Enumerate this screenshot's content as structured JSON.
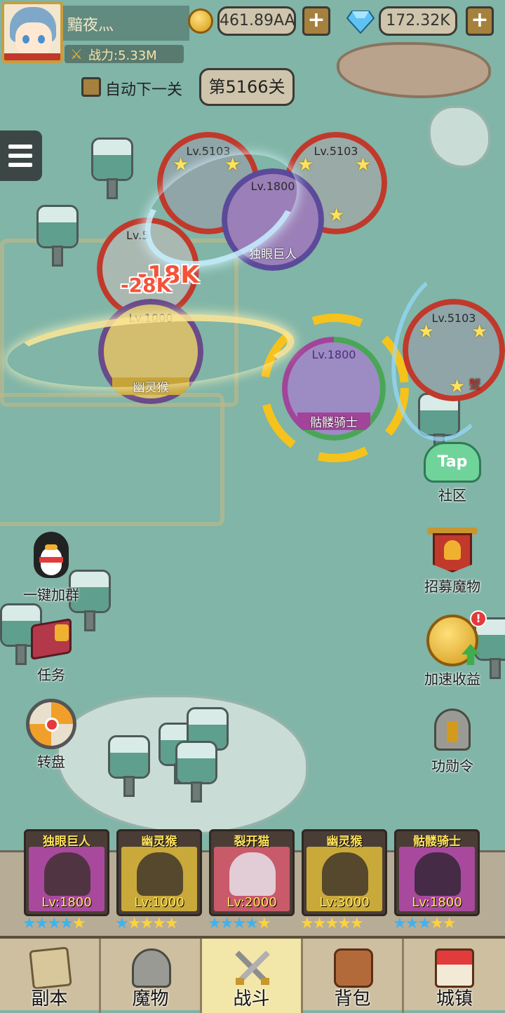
{
  "header": {
    "player_name": "黯夜灬",
    "power_label": "战力:5.33M",
    "gold": "461.89AA",
    "gems": "172.32K",
    "plus": "+"
  },
  "controls": {
    "auto_next_label": "自动下一关",
    "stage_label": "第5166关"
  },
  "battle_units": [
    {
      "level": "Lv.5103",
      "name": ""
    },
    {
      "level": "Lv.5103",
      "name": ""
    },
    {
      "level": "Lv.1800",
      "name": "独眼巨人"
    },
    {
      "level": "Lv.5",
      "name": ""
    },
    {
      "level": "Lv.1000",
      "name": "幽灵猴"
    },
    {
      "level": "Lv.1800",
      "name": "骷髅骑士"
    },
    {
      "level": "Lv.5103",
      "name": "蟹"
    }
  ],
  "damage_numbers": [
    "-18K",
    "-28K"
  ],
  "left_buttons": {
    "join_group": "一键加群",
    "tasks": "任务",
    "wheel": "转盘"
  },
  "right_buttons": {
    "community": "社区",
    "community_tap": "Tap",
    "recruit": "招募魔物",
    "speed_income": "加速收益",
    "merit": "功勋令",
    "badge": "!"
  },
  "team": [
    {
      "name": "独眼巨人",
      "level": "Lv:1800",
      "stars_blue": 4,
      "stars_gold": 1,
      "color": "#a8499e"
    },
    {
      "name": "幽灵猴",
      "level": "Lv:1000",
      "stars_blue": 1,
      "stars_gold": 4,
      "color": "#c9a93a"
    },
    {
      "name": "裂开猫",
      "level": "Lv:2000",
      "stars_blue": 4,
      "stars_gold": 1,
      "color": "#c85a6a"
    },
    {
      "name": "幽灵猴",
      "level": "Lv:3000",
      "stars_blue": 0,
      "stars_gold": 5,
      "color": "#c9a93a"
    },
    {
      "name": "骷髅骑士",
      "level": "Lv:1800",
      "stars_blue": 3,
      "stars_gold": 2,
      "color": "#a8499e"
    }
  ],
  "nav": {
    "dungeon": "副本",
    "monsters": "魔物",
    "battle": "战斗",
    "bag": "背包",
    "town": "城镇"
  }
}
